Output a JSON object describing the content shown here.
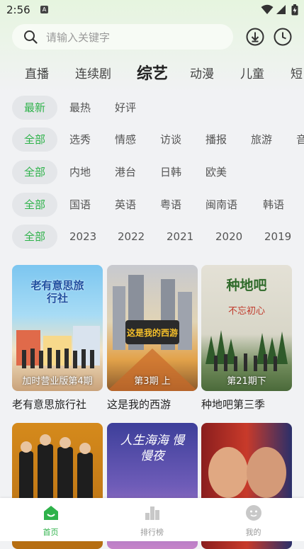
{
  "status_bar": {
    "time": "2:56",
    "notification_icon": "A"
  },
  "search": {
    "placeholder": "请输入关键字"
  },
  "channel_tabs": [
    "直播",
    "连续剧",
    "综艺",
    "动漫",
    "儿童",
    "短"
  ],
  "active_channel": "综艺",
  "filters": {
    "sort": [
      "最新",
      "最热",
      "好评"
    ],
    "type": [
      "全部",
      "选秀",
      "情感",
      "访谈",
      "播报",
      "旅游",
      "音"
    ],
    "region": [
      "全部",
      "内地",
      "港台",
      "日韩",
      "欧美"
    ],
    "language": [
      "全部",
      "国语",
      "英语",
      "粤语",
      "闽南语",
      "韩语"
    ],
    "year": [
      "全部",
      "2023",
      "2022",
      "2021",
      "2020",
      "2019"
    ]
  },
  "posters": [
    {
      "title": "老有意思旅行社",
      "episode": "加时营业版第4期",
      "art_text": "老有意思旅行社"
    },
    {
      "title": "这是我的西游",
      "episode": "第3期 上",
      "art_text": "这是我的西游"
    },
    {
      "title": "种地吧第三季",
      "episode": "第21期下",
      "art_text": "种地吧",
      "art_sub": "不忘初心"
    },
    {
      "title": "",
      "episode": ""
    },
    {
      "title": "",
      "episode": "",
      "art_text": "人生海海 慢慢夜"
    },
    {
      "title": "",
      "episode": ""
    }
  ],
  "bottom_nav": [
    {
      "label": "首页",
      "icon": "home-icon"
    },
    {
      "label": "排行榜",
      "icon": "ranking-icon"
    },
    {
      "label": "我的",
      "icon": "profile-icon"
    }
  ],
  "colors": {
    "accent": "#2eb24a",
    "chip_bg": "#e4e6e9",
    "page_bg": "#f1f2f4"
  }
}
